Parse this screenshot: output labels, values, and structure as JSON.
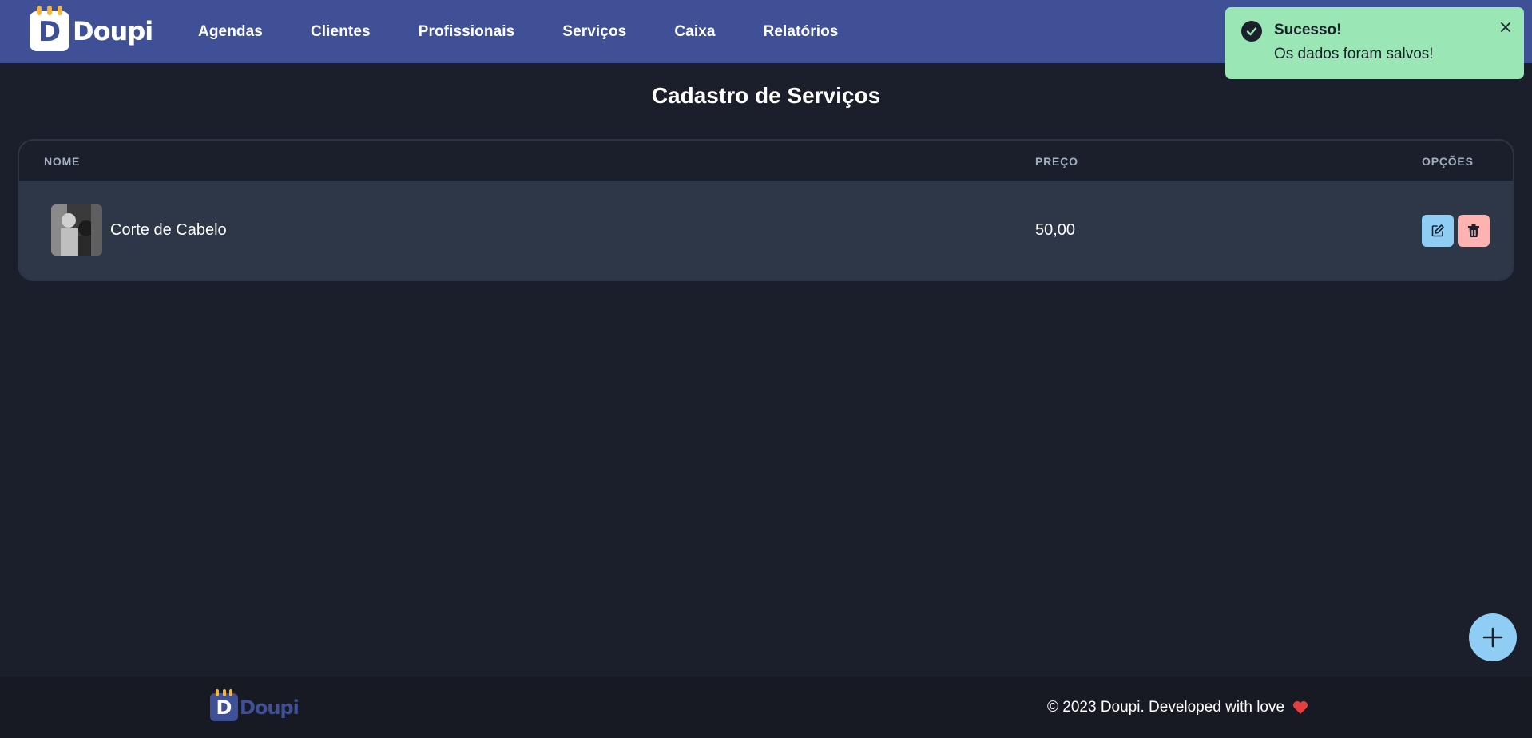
{
  "brand": {
    "name": "Doupi",
    "mark_letter": "D",
    "color": "#3f5096",
    "accent": "#f3b444"
  },
  "nav": {
    "items": [
      {
        "label": "Agendas"
      },
      {
        "label": "Clientes"
      },
      {
        "label": "Profissionais"
      },
      {
        "label": "Serviços"
      },
      {
        "label": "Caixa"
      },
      {
        "label": "Relatórios"
      }
    ]
  },
  "toast": {
    "title": "Sucesso!",
    "description": "Os dados foram salvos!",
    "icon": "check-circle-icon",
    "color": "#9ae6b4"
  },
  "page": {
    "title": "Cadastro de Serviços"
  },
  "table": {
    "columns": {
      "name": "NOME",
      "price": "PREÇO",
      "options": "OPÇÕES"
    },
    "rows": [
      {
        "name": "Corte de Cabelo",
        "price": "50,00",
        "thumbnail": "barber-photo"
      }
    ],
    "actions": {
      "edit_icon": "edit-icon",
      "delete_icon": "trash-icon",
      "edit_color": "#90cdf4",
      "delete_color": "#feb2b2"
    }
  },
  "fab": {
    "icon": "plus-icon"
  },
  "footer": {
    "copyright": "© 2023 Doupi. Developed with love",
    "heart_icon": "heart-icon"
  }
}
